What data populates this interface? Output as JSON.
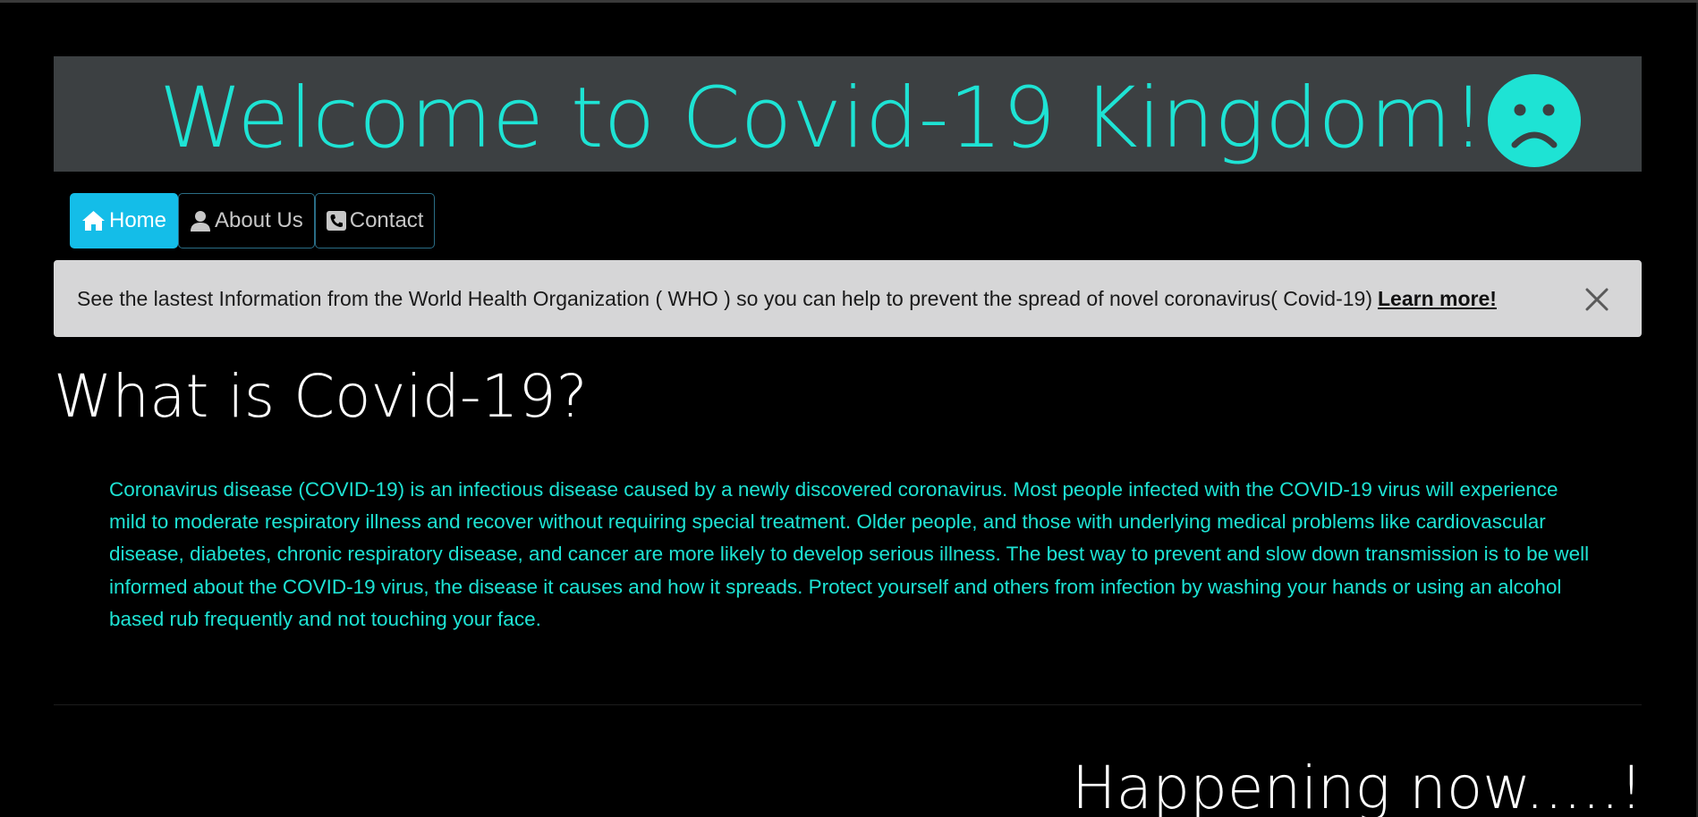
{
  "header": {
    "title": "Welcome to Covid-19 Kingdom!",
    "accent_color": "#1ee3d4",
    "band_color": "#3c4042",
    "emoji_icon": "frowning-face-icon"
  },
  "nav": {
    "items": [
      {
        "label": "Home",
        "icon": "home-icon",
        "active": true
      },
      {
        "label": "About Us",
        "icon": "user-icon",
        "active": false
      },
      {
        "label": "Contact",
        "icon": "phone-square-icon",
        "active": false
      }
    ],
    "active_color": "#14bde8"
  },
  "alert": {
    "text": "See the lastest Information from the World Health Organization ( WHO ) so you can help to prevent the spread of novel coronavirus( Covid-19)",
    "link_label": "Learn more!",
    "close_icon": "close-icon",
    "background_color": "#d6d6d7"
  },
  "main": {
    "section_title": "What is Covid-19?",
    "paragraph": "Coronavirus disease (COVID-19) is an infectious disease caused by a newly discovered coronavirus. Most people infected with the COVID-19 virus will experience mild to moderate respiratory illness and recover without requiring special treatment. Older people, and those with underlying medical problems like cardiovascular disease, diabetes, chronic respiratory disease, and cancer are more likely to develop serious illness. The best way to prevent and slow down transmission is to be well informed about the COVID-19 virus, the disease it causes and how it spreads. Protect yourself and others from infection by washing your hands or using an alcohol based rub frequently and not touching your face.",
    "next_heading": "Happening now.....!"
  }
}
